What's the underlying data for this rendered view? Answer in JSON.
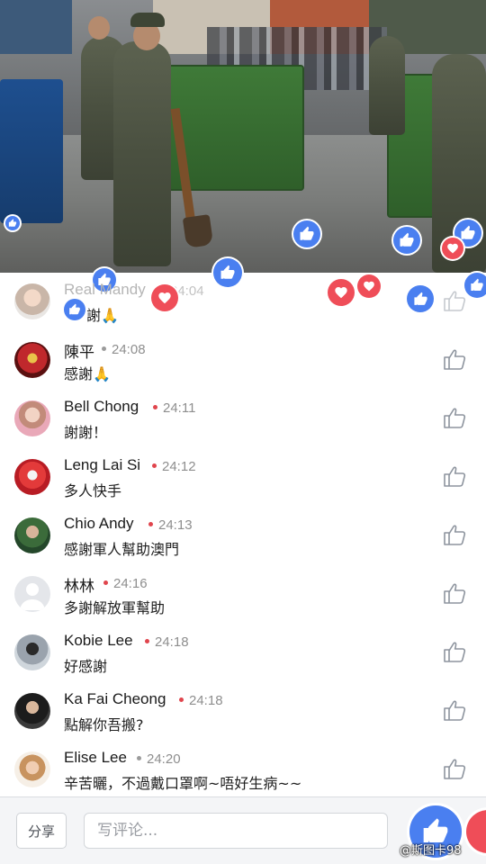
{
  "video": {
    "reactions": [
      {
        "type": "like"
      },
      {
        "type": "like"
      },
      {
        "type": "like"
      },
      {
        "type": "like"
      },
      {
        "type": "love"
      },
      {
        "type": "like"
      },
      {
        "type": "like"
      }
    ]
  },
  "comments": [
    {
      "name": "Real Mandy",
      "time": "24:04",
      "text": "謝🙏",
      "dot_color": "#bdbdbd",
      "avatar": "photo-light"
    },
    {
      "name": "陳平",
      "time": "24:08",
      "text": "感謝🙏",
      "dot_color": "#9b9b9b",
      "avatar": "photo-red"
    },
    {
      "name": "Bell Chong",
      "time": "24:11",
      "text": "謝謝！",
      "dot_color": "#e0454d",
      "avatar": "photo-pink"
    },
    {
      "name": "Leng Lai Si",
      "time": "24:12",
      "text": "多人快手",
      "dot_color": "#e0454d",
      "avatar": "photo-red2"
    },
    {
      "name": "Chio Andy",
      "time": "24:13",
      "text": "感謝軍人幫助澳門",
      "dot_color": "#e0454d",
      "avatar": "photo-green"
    },
    {
      "name": "林林",
      "time": "24:16",
      "text": "多謝解放軍幫助",
      "dot_color": "#e0454d",
      "avatar": "default"
    },
    {
      "name": "Kobie Lee",
      "time": "24:18",
      "text": "好感謝",
      "dot_color": "#e0454d",
      "avatar": "photo-gray"
    },
    {
      "name": "Ka Fai Cheong",
      "time": "24:18",
      "text": "點解你吾搬?",
      "dot_color": "#e0454d",
      "avatar": "photo-dark"
    },
    {
      "name": "Elise Lee",
      "time": "24:20",
      "text": "辛苦曬，不過戴口罩啊~唔好生病~~",
      "dot_color": "#9b9b9b",
      "avatar": "photo-child"
    }
  ],
  "bottom": {
    "share_label": "分享",
    "comment_placeholder": "写评论..."
  },
  "watermark": "@斯图卡98",
  "colors": {
    "like_blue": "#4a7ff0",
    "love_red": "#ef4d58",
    "time_dot_red": "#e0454d"
  },
  "icons": {
    "comment_like": "thumbs-up-outline-icon",
    "reaction_like": "thumbs-up-icon",
    "reaction_love": "heart-icon"
  }
}
